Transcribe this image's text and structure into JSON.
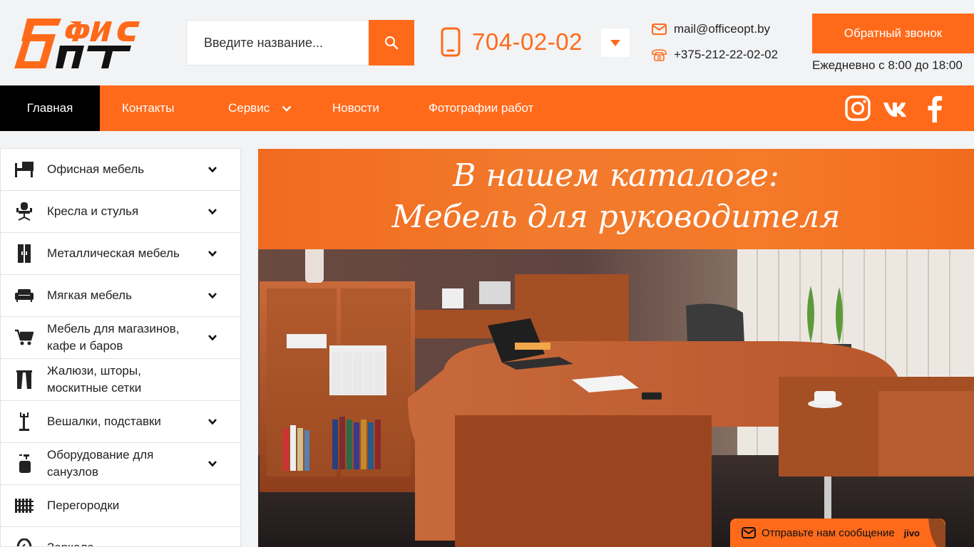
{
  "header": {
    "search_placeholder": "Введите название...",
    "phone": "704-02-02",
    "email": "mail@officeopt.by",
    "phone2": "+375-212-22-02-02",
    "callback_label": "Обратный звонок",
    "hours": "Ежедневно с 8:00 до 18:00"
  },
  "nav": {
    "items": [
      {
        "label": "Главная"
      },
      {
        "label": "Контакты"
      },
      {
        "label": "Сервис"
      },
      {
        "label": "Новости"
      },
      {
        "label": "Фотографии работ"
      }
    ]
  },
  "sidebar": {
    "items": [
      {
        "label": "Офисная мебель",
        "icon": "desk-icon"
      },
      {
        "label": "Кресла и стулья",
        "icon": "office-chair-icon"
      },
      {
        "label": "Металлическая мебель",
        "icon": "metal-cabinet-icon"
      },
      {
        "label": "Мягкая мебель",
        "icon": "sofa-icon"
      },
      {
        "label": "Мебель для магазинов, кафе и баров",
        "icon": "cart-icon"
      },
      {
        "label": "Жалюзи, шторы, москитные сетки",
        "icon": "blinds-icon"
      },
      {
        "label": "Вешалки, подставки",
        "icon": "coat-rack-icon"
      },
      {
        "label": "Оборудование для санузлов",
        "icon": "soap-dispenser-icon"
      },
      {
        "label": "Перегородки",
        "icon": "partition-icon"
      },
      {
        "label": "Зеркала",
        "icon": "mirror-icon"
      }
    ]
  },
  "banner": {
    "line1": "В нашем каталоге:",
    "line2": "Мебель для руководителя"
  },
  "chat": {
    "label": "Отправьте нам сообщение",
    "brand": "jivo"
  },
  "colors": {
    "accent": "#ff6a1a",
    "nav_active": "#000000"
  }
}
